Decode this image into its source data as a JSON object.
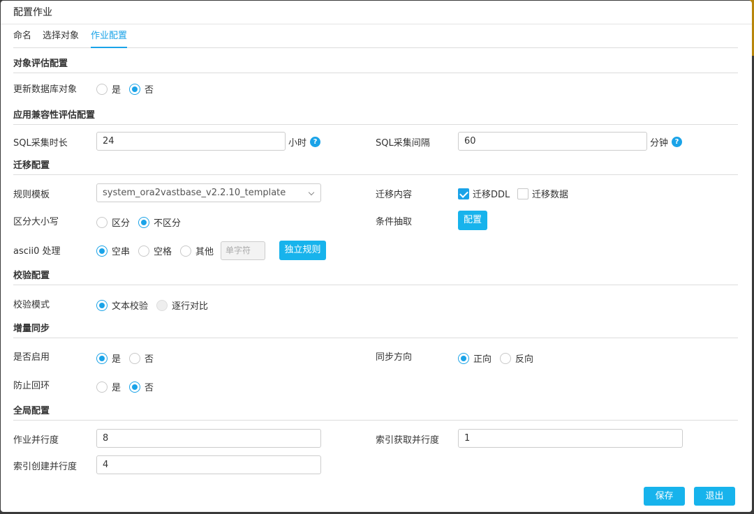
{
  "dialog": {
    "title": "配置作业"
  },
  "tabs": [
    "命名",
    "选择对象",
    "作业配置"
  ],
  "sections": {
    "object_eval": "对象评估配置",
    "app_compat": "应用兼容性评估配置",
    "migration": "迁移配置",
    "validation": "校验配置",
    "incremental": "增量同步",
    "global": "全局配置"
  },
  "object_eval": {
    "update_db_label": "更新数据库对象",
    "options": [
      "是",
      "否"
    ],
    "selected": "否"
  },
  "app_compat": {
    "sql_duration_label": "SQL采集时长",
    "sql_duration_value": "24",
    "sql_duration_unit": "小时",
    "sql_interval_label": "SQL采集间隔",
    "sql_interval_value": "60",
    "sql_interval_unit": "分钟",
    "help_glyph": "?"
  },
  "migration": {
    "rule_template_label": "规则模板",
    "rule_template_value": "system_ora2vastbase_v2.2.10_template",
    "content_label": "迁移内容",
    "content_options": [
      {
        "label": "迁移DDL",
        "checked": true
      },
      {
        "label": "迁移数据",
        "checked": false
      }
    ],
    "case_label": "区分大小写",
    "case_options": [
      "区分",
      "不区分"
    ],
    "case_selected": "不区分",
    "condition_label": "条件抽取",
    "condition_button": "配置",
    "ascii_label": "ascii0 处理",
    "ascii_options": [
      "空串",
      "空格",
      "其他"
    ],
    "ascii_selected": "空串",
    "ascii_placeholder": "单字符",
    "independent_rule_button": "独立规则"
  },
  "validation": {
    "mode_label": "校验模式",
    "options": [
      "文本校验",
      "逐行对比"
    ],
    "selected": "文本校验"
  },
  "incremental": {
    "enable_label": "是否启用",
    "enable_options": [
      "是",
      "否"
    ],
    "enable_selected": "是",
    "direction_label": "同步方向",
    "direction_options": [
      "正向",
      "反向"
    ],
    "direction_selected": "正向",
    "loop_label": "防止回环",
    "loop_options": [
      "是",
      "否"
    ],
    "loop_selected": "否"
  },
  "global": {
    "job_parallel_label": "作业并行度",
    "job_parallel_value": "8",
    "index_fetch_label": "索引获取并行度",
    "index_fetch_value": "1",
    "index_create_label": "索引创建并行度",
    "index_create_value": "4"
  },
  "footer": {
    "save": "保存",
    "exit": "退出"
  },
  "colors": {
    "accent": "#1aa3e8",
    "button": "#17b3ec"
  }
}
